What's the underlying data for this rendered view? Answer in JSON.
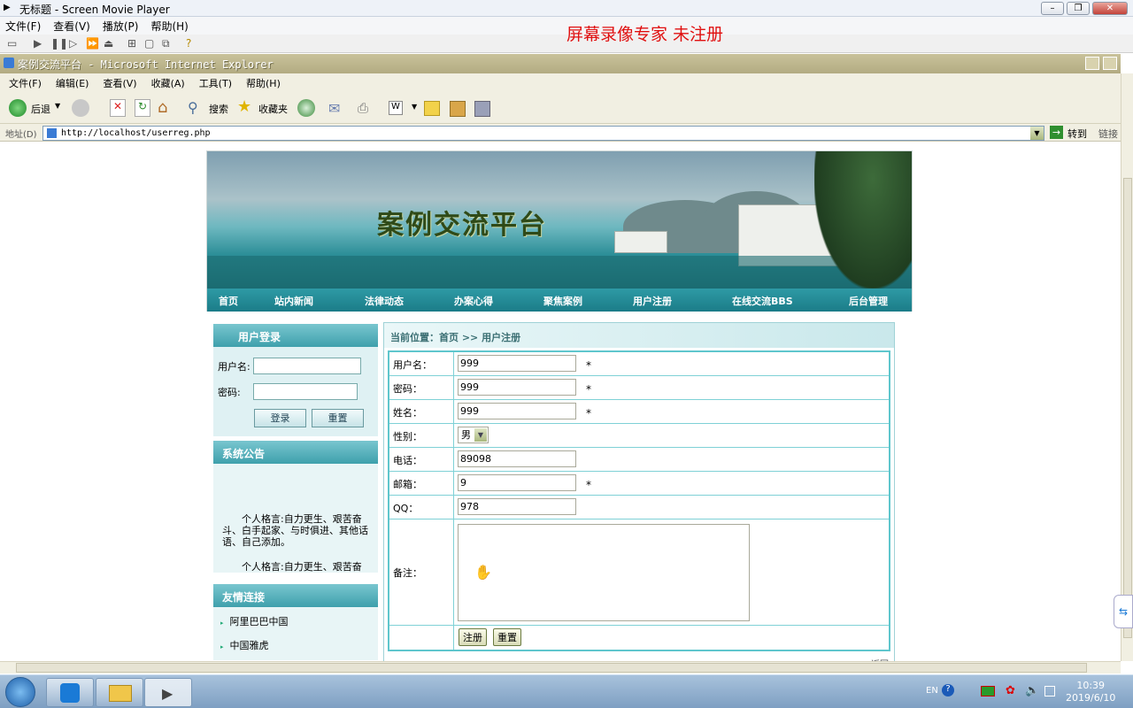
{
  "player": {
    "title": "无标题 - Screen Movie Player",
    "menu": [
      "文件(F)",
      "查看(V)",
      "播放(P)",
      "帮助(H)"
    ],
    "watermark": "屏幕录像专家  未注册"
  },
  "browser": {
    "title": "案例交流平台 - Microsoft Internet Explorer",
    "menu": [
      "文件(F)",
      "编辑(E)",
      "查看(V)",
      "收藏(A)",
      "工具(T)",
      "帮助(H)"
    ],
    "toolbar": {
      "back": "后退",
      "search": "搜索",
      "favorites": "收藏夹"
    },
    "address": {
      "label": "地址(D)",
      "url": "http://localhost/userreg.php",
      "go": "转到",
      "links": "链接"
    }
  },
  "site": {
    "title": "案例交流平台",
    "nav": [
      "首页",
      "站内新闻",
      "法律动态",
      "办案心得",
      "聚焦案例",
      "用户注册",
      "在线交流BBS",
      "后台管理"
    ]
  },
  "login": {
    "heading": "用户登录",
    "user_label": "用户名:",
    "pass_label": "密码:",
    "login_btn": "登录",
    "reset_btn": "重置"
  },
  "notice": {
    "heading": "系统公告",
    "items": [
      "个人格言:自力更生、艰苦奋斗、白手起家、与时俱进、其他话语、自己添加。",
      "个人格言:自力更生、艰苦奋斗、白手起家、与时俱进、其他话语、自己添加。"
    ]
  },
  "links": {
    "heading": "友情连接",
    "items": [
      "阿里巴巴中国",
      "中国雅虎"
    ]
  },
  "register": {
    "breadcrumb": "当前位置：首页  >> 用户注册",
    "fields": {
      "username": {
        "label": "用户名：",
        "value": "999",
        "required": "*"
      },
      "password": {
        "label": "密码：",
        "value": "999",
        "required": "*"
      },
      "name": {
        "label": "姓名：",
        "value": "999",
        "required": "*"
      },
      "gender": {
        "label": "性别：",
        "value": "男"
      },
      "phone": {
        "label": "电话：",
        "value": "89098"
      },
      "email": {
        "label": "邮箱：",
        "value": "9",
        "required": "*"
      },
      "qq": {
        "label": "QQ：",
        "value": "978"
      },
      "remark": {
        "label": "备注：",
        "value": ""
      }
    },
    "submit": "注册",
    "reset": "重置",
    "back": "返回"
  },
  "taskbar": {
    "lang": "EN",
    "time": "10:39",
    "date": "2019/6/10"
  }
}
